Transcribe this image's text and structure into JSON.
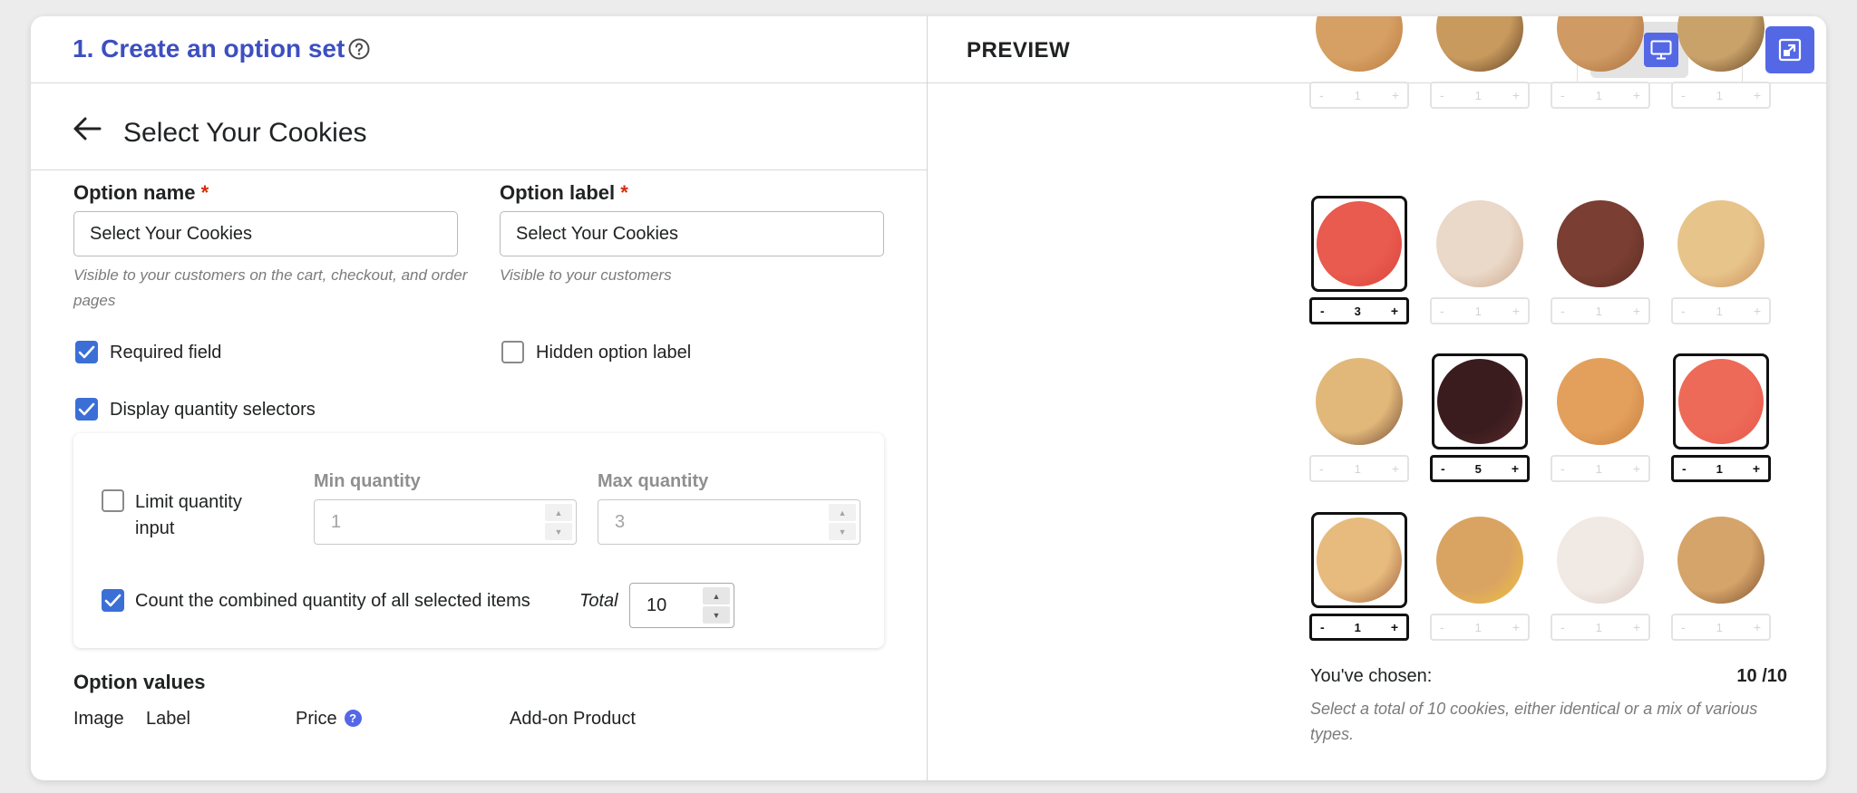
{
  "header": {
    "step_title": "1. Create an option set",
    "preview_label": "PREVIEW"
  },
  "subheader": {
    "title": "Select Your Cookies"
  },
  "form": {
    "option_name": {
      "label": "Option name",
      "required_mark": "*",
      "value": "Select Your Cookies",
      "help": "Visible to your customers on the cart, checkout, and order pages"
    },
    "option_label": {
      "label": "Option label",
      "required_mark": "*",
      "value": "Select Your Cookies",
      "help": "Visible to your customers"
    },
    "required_field": {
      "label": "Required field",
      "checked": true
    },
    "hidden_option_label": {
      "label": "Hidden option label",
      "checked": false
    },
    "display_quantity_selectors": {
      "label": "Display quantity selectors",
      "checked": true
    },
    "limit_quantity": {
      "label_line1": "Limit quantity",
      "label_line2": "input",
      "checked": false
    },
    "min_quantity": {
      "label": "Min quantity",
      "value": "1"
    },
    "max_quantity": {
      "label": "Max quantity",
      "value": "3"
    },
    "count_combined": {
      "label": "Count the combined quantity of all selected items",
      "checked": true
    },
    "total": {
      "label": "Total",
      "value": "10"
    }
  },
  "option_values": {
    "title": "Option values",
    "columns": {
      "image": "Image",
      "label": "Label",
      "price": "Price",
      "price_help": "?",
      "addon": "Add-on Product"
    }
  },
  "preview": {
    "cookies": [
      {
        "row": 0,
        "col": 0,
        "qty": "1",
        "selected": false
      },
      {
        "row": 0,
        "col": 1,
        "qty": "1",
        "selected": false
      },
      {
        "row": 0,
        "col": 2,
        "qty": "1",
        "selected": false
      },
      {
        "row": 0,
        "col": 3,
        "qty": "1",
        "selected": false
      },
      {
        "row": 1,
        "col": 0,
        "qty": "3",
        "selected": true
      },
      {
        "row": 1,
        "col": 1,
        "qty": "1",
        "selected": false
      },
      {
        "row": 1,
        "col": 2,
        "qty": "1",
        "selected": false
      },
      {
        "row": 1,
        "col": 3,
        "qty": "1",
        "selected": false
      },
      {
        "row": 2,
        "col": 0,
        "qty": "1",
        "selected": false
      },
      {
        "row": 2,
        "col": 1,
        "qty": "5",
        "selected": true
      },
      {
        "row": 2,
        "col": 2,
        "qty": "1",
        "selected": false
      },
      {
        "row": 2,
        "col": 3,
        "qty": "1",
        "selected": true
      },
      {
        "row": 3,
        "col": 0,
        "qty": "1",
        "selected": true
      },
      {
        "row": 3,
        "col": 1,
        "qty": "1",
        "selected": false
      },
      {
        "row": 3,
        "col": 2,
        "qty": "1",
        "selected": false
      },
      {
        "row": 3,
        "col": 3,
        "qty": "1",
        "selected": false
      }
    ],
    "minus": "-",
    "plus": "+",
    "chosen_label": "You've chosen:",
    "chosen_value": "10 /10",
    "chosen_note": "Select a total of 10 cookies, either identical or a mix of various types."
  },
  "colors": {
    "accent": "#5468e6",
    "title": "#3d4fbf",
    "checkbox": "#3b6fd6",
    "required": "#d72c0d"
  }
}
